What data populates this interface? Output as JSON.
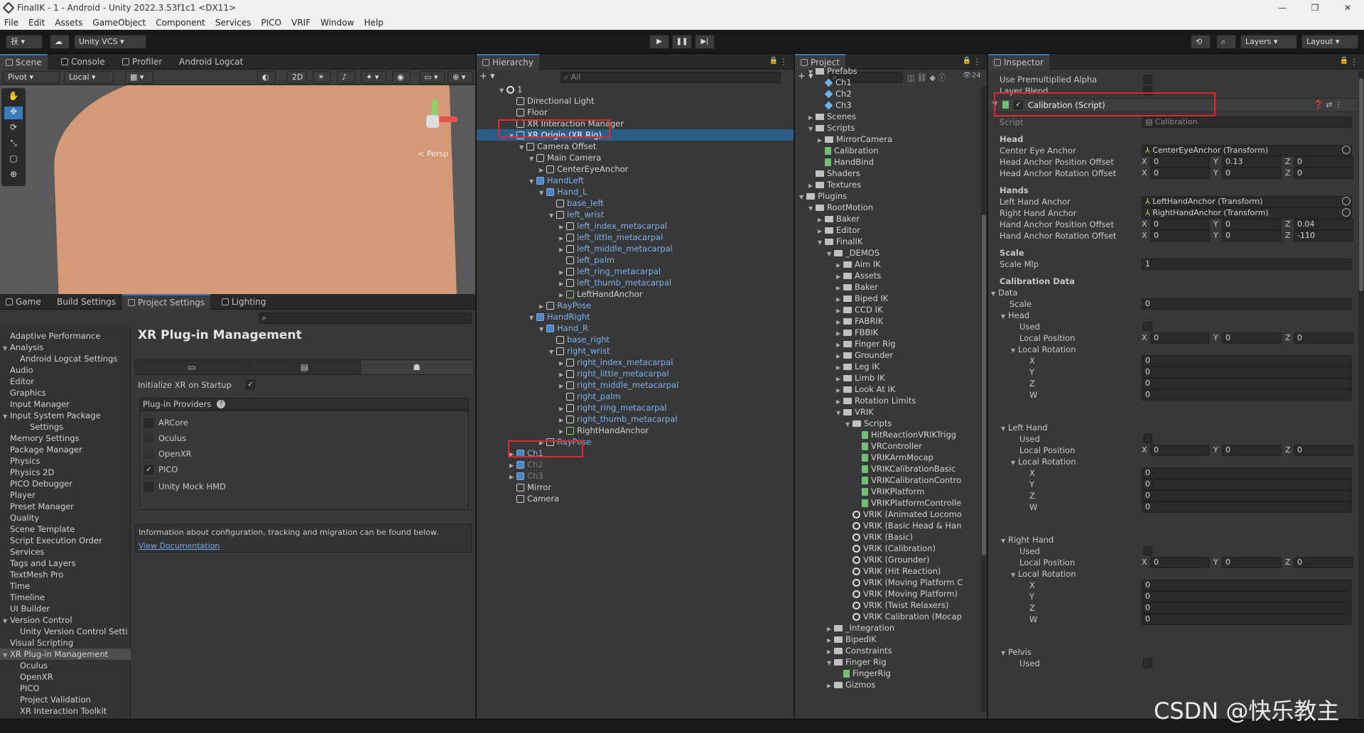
{
  "window": {
    "title": "FinalIK - 1 - Android - Unity 2022.3.53f1c1 <DX11>",
    "controls": [
      "—",
      "❐",
      "✕"
    ]
  },
  "menu": [
    "File",
    "Edit",
    "Assets",
    "GameObject",
    "Component",
    "Services",
    "PICO",
    "VRIF",
    "Window",
    "Help"
  ],
  "toolbar": {
    "account": "祆 ▾",
    "cloud": "☁",
    "vcs": "Unity VCS ▾",
    "play": "▶",
    "pause": "❚❚",
    "step": "▶|",
    "history": "⟲",
    "search": "⌕",
    "layers": "Layers",
    "layout": "Layout"
  },
  "scene": {
    "tabs": [
      "Scene",
      "Console",
      "Profiler",
      "Android Logcat"
    ],
    "pivot": "Pivot",
    "local": "Local",
    "twod": "2D",
    "persp": "< Persp",
    "skin_color": "#d49a77"
  },
  "settings": {
    "tabs": [
      "Game",
      "Build Settings",
      "Project Settings",
      "Lighting"
    ],
    "list": [
      "Adaptive Performance",
      "Analysis",
      "Android Logcat Settings",
      "Audio",
      "Editor",
      "Graphics",
      "Input Manager",
      "Input System Package",
      "Settings",
      "Memory Settings",
      "Package Manager",
      "Physics",
      "Physics 2D",
      "PICO Debugger",
      "Player",
      "Preset Manager",
      "Quality",
      "Scene Template",
      "Script Execution Order",
      "Services",
      "Tags and Layers",
      "TextMesh Pro",
      "Time",
      "Timeline",
      "UI Builder",
      "Version Control",
      "Unity Version Control Setti",
      "Visual Scripting",
      "XR Plug-in Management",
      "Oculus",
      "OpenXR",
      "PICO",
      "Project Validation",
      "XR Interaction Toolkit"
    ],
    "title": "XR Plug-in Management",
    "init_label": "Initialize XR on Startup",
    "providers_label": "Plug-in Providers",
    "providers": [
      "ARCore",
      "Oculus",
      "OpenXR",
      "PICO",
      "Unity Mock HMD"
    ],
    "info": "Information about configuration, tracking and migration can be found below.",
    "doc_link": "View Documentation"
  },
  "hierarchy": {
    "tab": "Hierarchy",
    "search_placeholder": "All",
    "items": [
      "1",
      "Directional Light",
      "Floor",
      "XR Interaction Manager",
      "XR Origin (XR Rig)",
      "Camera Offset",
      "Main Camera",
      "CenterEyeAnchor",
      "HandLeft",
      "Hand_L",
      "base_left",
      "left_wrist",
      "left_index_metacarpal",
      "left_little_metacarpal",
      "left_middle_metacarpal",
      "left_palm",
      "left_ring_metacarpal",
      "left_thumb_metacarpal",
      "LeftHandAnchor",
      "RayPose",
      "HandRight",
      "Hand_R",
      "base_right",
      "right_wrist",
      "right_index_metacarpal",
      "right_little_metacarpal",
      "right_middle_metacarpal",
      "right_palm",
      "right_ring_metacarpal",
      "right_thumb_metacarpal",
      "RightHandAnchor",
      "RayPose",
      "Ch1",
      "Ch2",
      "Ch3",
      "Mirror",
      "Camera"
    ]
  },
  "project": {
    "tab": "Project",
    "count": "24",
    "items": [
      "Prefabs",
      "Ch1",
      "Ch2",
      "Ch3",
      "Scenes",
      "Scripts",
      "MirrorCamera",
      "Calibration",
      "HandBind",
      "Shaders",
      "Textures",
      "Plugins",
      "RootMotion",
      "Baker",
      "Editor",
      "FinalIK",
      "_DEMOS",
      "Aim IK",
      "Assets",
      "Baker",
      "Biped IK",
      "CCD IK",
      "FABRIK",
      "FBBIK",
      "Finger Rig",
      "Grounder",
      "Leg IK",
      "Limb IK",
      "Look At IK",
      "Rotation Limits",
      "VRIK",
      "Scripts",
      "HitReactionVRIKTrigg",
      "VRController",
      "VRIKArmMocap",
      "VRIKCalibrationBasic",
      "VRIKCalibrationContro",
      "VRIKPlatform",
      "VRIKPlatformControlle",
      "VRIK (Animated Locomo",
      "VRIK (Basic Head & Han",
      "VRIK (Basic)",
      "VRIK (Calibration)",
      "VRIK (Grounder)",
      "VRIK (Hit Reaction)",
      "VRIK (Moving Platform C",
      "VRIK (Moving Platform)",
      "VRIK (Twist Relaxers)",
      "VRIK Calibration (Mocap",
      "_Integration",
      "BipedIK",
      "Constraints",
      "Finger Rig",
      "FingerRig",
      "Gizmos"
    ]
  },
  "inspector": {
    "tab": "Inspector",
    "use_premult": "Use Premultiplied Alpha",
    "layer_blend": "Layer Blend",
    "component": "Calibration (Script)",
    "script_label": "Script",
    "script_value": "Calibration",
    "head_header": "Head",
    "center_eye": "Center Eye Anchor",
    "center_eye_value": "CenterEyeAnchor (Transform)",
    "head_pos": "Head Anchor Position Offset",
    "head_pos_vals": [
      "0",
      "0.13",
      "0"
    ],
    "head_rot": "Head Anchor Rotation Offset",
    "head_rot_vals": [
      "0",
      "0",
      "0"
    ],
    "hands_header": "Hands",
    "left_hand": "Left Hand Anchor",
    "left_hand_value": "LeftHandAnchor (Transform)",
    "right_hand": "Right Hand Anchor",
    "right_hand_value": "RightHandAnchor (Transform)",
    "hand_pos": "Hand Anchor Position Offset",
    "hand_pos_vals": [
      "0",
      "0",
      "0.04"
    ],
    "hand_rot": "Hand Anchor Rotation Offset",
    "hand_rot_vals": [
      "0",
      "0",
      "-110"
    ],
    "scale_header": "Scale",
    "scale_mlp": "Scale Mlp",
    "scale_mlp_value": "1",
    "calib_header": "Calibration Data",
    "data": "Data",
    "scale": "Scale",
    "scale_value": "0",
    "head": "Head",
    "used": "Used",
    "local_pos": "Local Position",
    "local_rot": "Local Rotation",
    "zero": "0",
    "x": "X",
    "y": "Y",
    "z": "Z",
    "w": "W",
    "left": "Left Hand",
    "right": "Right Hand",
    "pelvis": "Pelvis"
  },
  "watermark": "CSDN @快乐教主"
}
